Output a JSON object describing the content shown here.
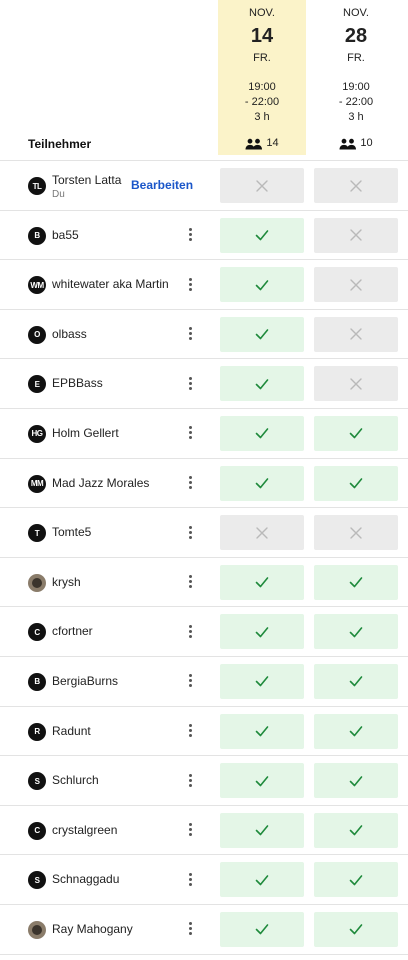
{
  "header": {
    "participants_label": "Teilnehmer",
    "dates": [
      {
        "month": "NOV.",
        "day": "14",
        "weekday": "FR.",
        "time_start": "19:00",
        "time_end": "- 22:00",
        "duration": "3 h",
        "count": "14",
        "highlighted": true
      },
      {
        "month": "NOV.",
        "day": "28",
        "weekday": "FR.",
        "time_start": "19:00",
        "time_end": "- 22:00",
        "duration": "3 h",
        "count": "10",
        "highlighted": false
      }
    ]
  },
  "current_user": {
    "edit_label": "Bearbeiten",
    "subtitle": "Du"
  },
  "colors": {
    "yes_bg": "#e4f6e7",
    "no_bg": "#ebebeb",
    "check": "#1f8a3c",
    "cross": "#b9b9b9",
    "highlight": "#fbf3c9",
    "link": "#1a56c9"
  },
  "participants": [
    {
      "initials": "TL",
      "name": "Torsten Latta",
      "is_self": true,
      "votes": [
        "no",
        "no"
      ]
    },
    {
      "initials": "B",
      "name": "ba55",
      "votes": [
        "yes",
        "no"
      ]
    },
    {
      "initials": "WM",
      "name": "whitewater aka Martin",
      "votes": [
        "yes",
        "no"
      ]
    },
    {
      "initials": "O",
      "name": "olbass",
      "votes": [
        "yes",
        "no"
      ]
    },
    {
      "initials": "E",
      "name": "EPBBass",
      "votes": [
        "yes",
        "no"
      ]
    },
    {
      "initials": "HG",
      "name": "Holm Gellert",
      "votes": [
        "yes",
        "yes"
      ]
    },
    {
      "initials": "MM",
      "name": "Mad Jazz Morales",
      "votes": [
        "yes",
        "yes"
      ]
    },
    {
      "initials": "T",
      "name": "Tomte5",
      "votes": [
        "no",
        "no"
      ]
    },
    {
      "initials": "",
      "photo": true,
      "name": "krysh",
      "votes": [
        "yes",
        "yes"
      ]
    },
    {
      "initials": "C",
      "name": "cfortner",
      "votes": [
        "yes",
        "yes"
      ]
    },
    {
      "initials": "B",
      "name": "BergiaBurns",
      "votes": [
        "yes",
        "yes"
      ]
    },
    {
      "initials": "R",
      "name": "Radunt",
      "votes": [
        "yes",
        "yes"
      ]
    },
    {
      "initials": "S",
      "name": "Schlurch",
      "votes": [
        "yes",
        "yes"
      ]
    },
    {
      "initials": "C",
      "name": "crystalgreen",
      "votes": [
        "yes",
        "yes"
      ]
    },
    {
      "initials": "S",
      "name": "Schnaggadu",
      "votes": [
        "yes",
        "yes"
      ]
    },
    {
      "initials": "",
      "photo": true,
      "name": "Ray Mahogany",
      "votes": [
        "yes",
        "yes"
      ]
    }
  ]
}
